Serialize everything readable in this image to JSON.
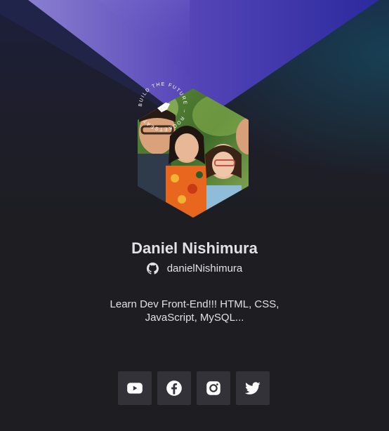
{
  "profile": {
    "name": "Daniel Nishimura",
    "github_username": "danielNishimura",
    "bio": "Learn Dev Front-End!!! HTML, CSS, JavaScript, MySQL...",
    "badge_text": "BUILD THE FUTURE → ROCKETSEAT"
  },
  "social": [
    {
      "icon": "youtube-icon",
      "label": "YouTube"
    },
    {
      "icon": "facebook-icon",
      "label": "Facebook"
    },
    {
      "icon": "instagram-icon",
      "label": "Instagram"
    },
    {
      "icon": "twitter-icon",
      "label": "Twitter"
    }
  ],
  "colors": {
    "background": "#1d1d22",
    "button": "#323238",
    "text": "#e1e1e6",
    "accent_purple": "#5b3fc4",
    "accent_teal": "#1a5a6e"
  }
}
